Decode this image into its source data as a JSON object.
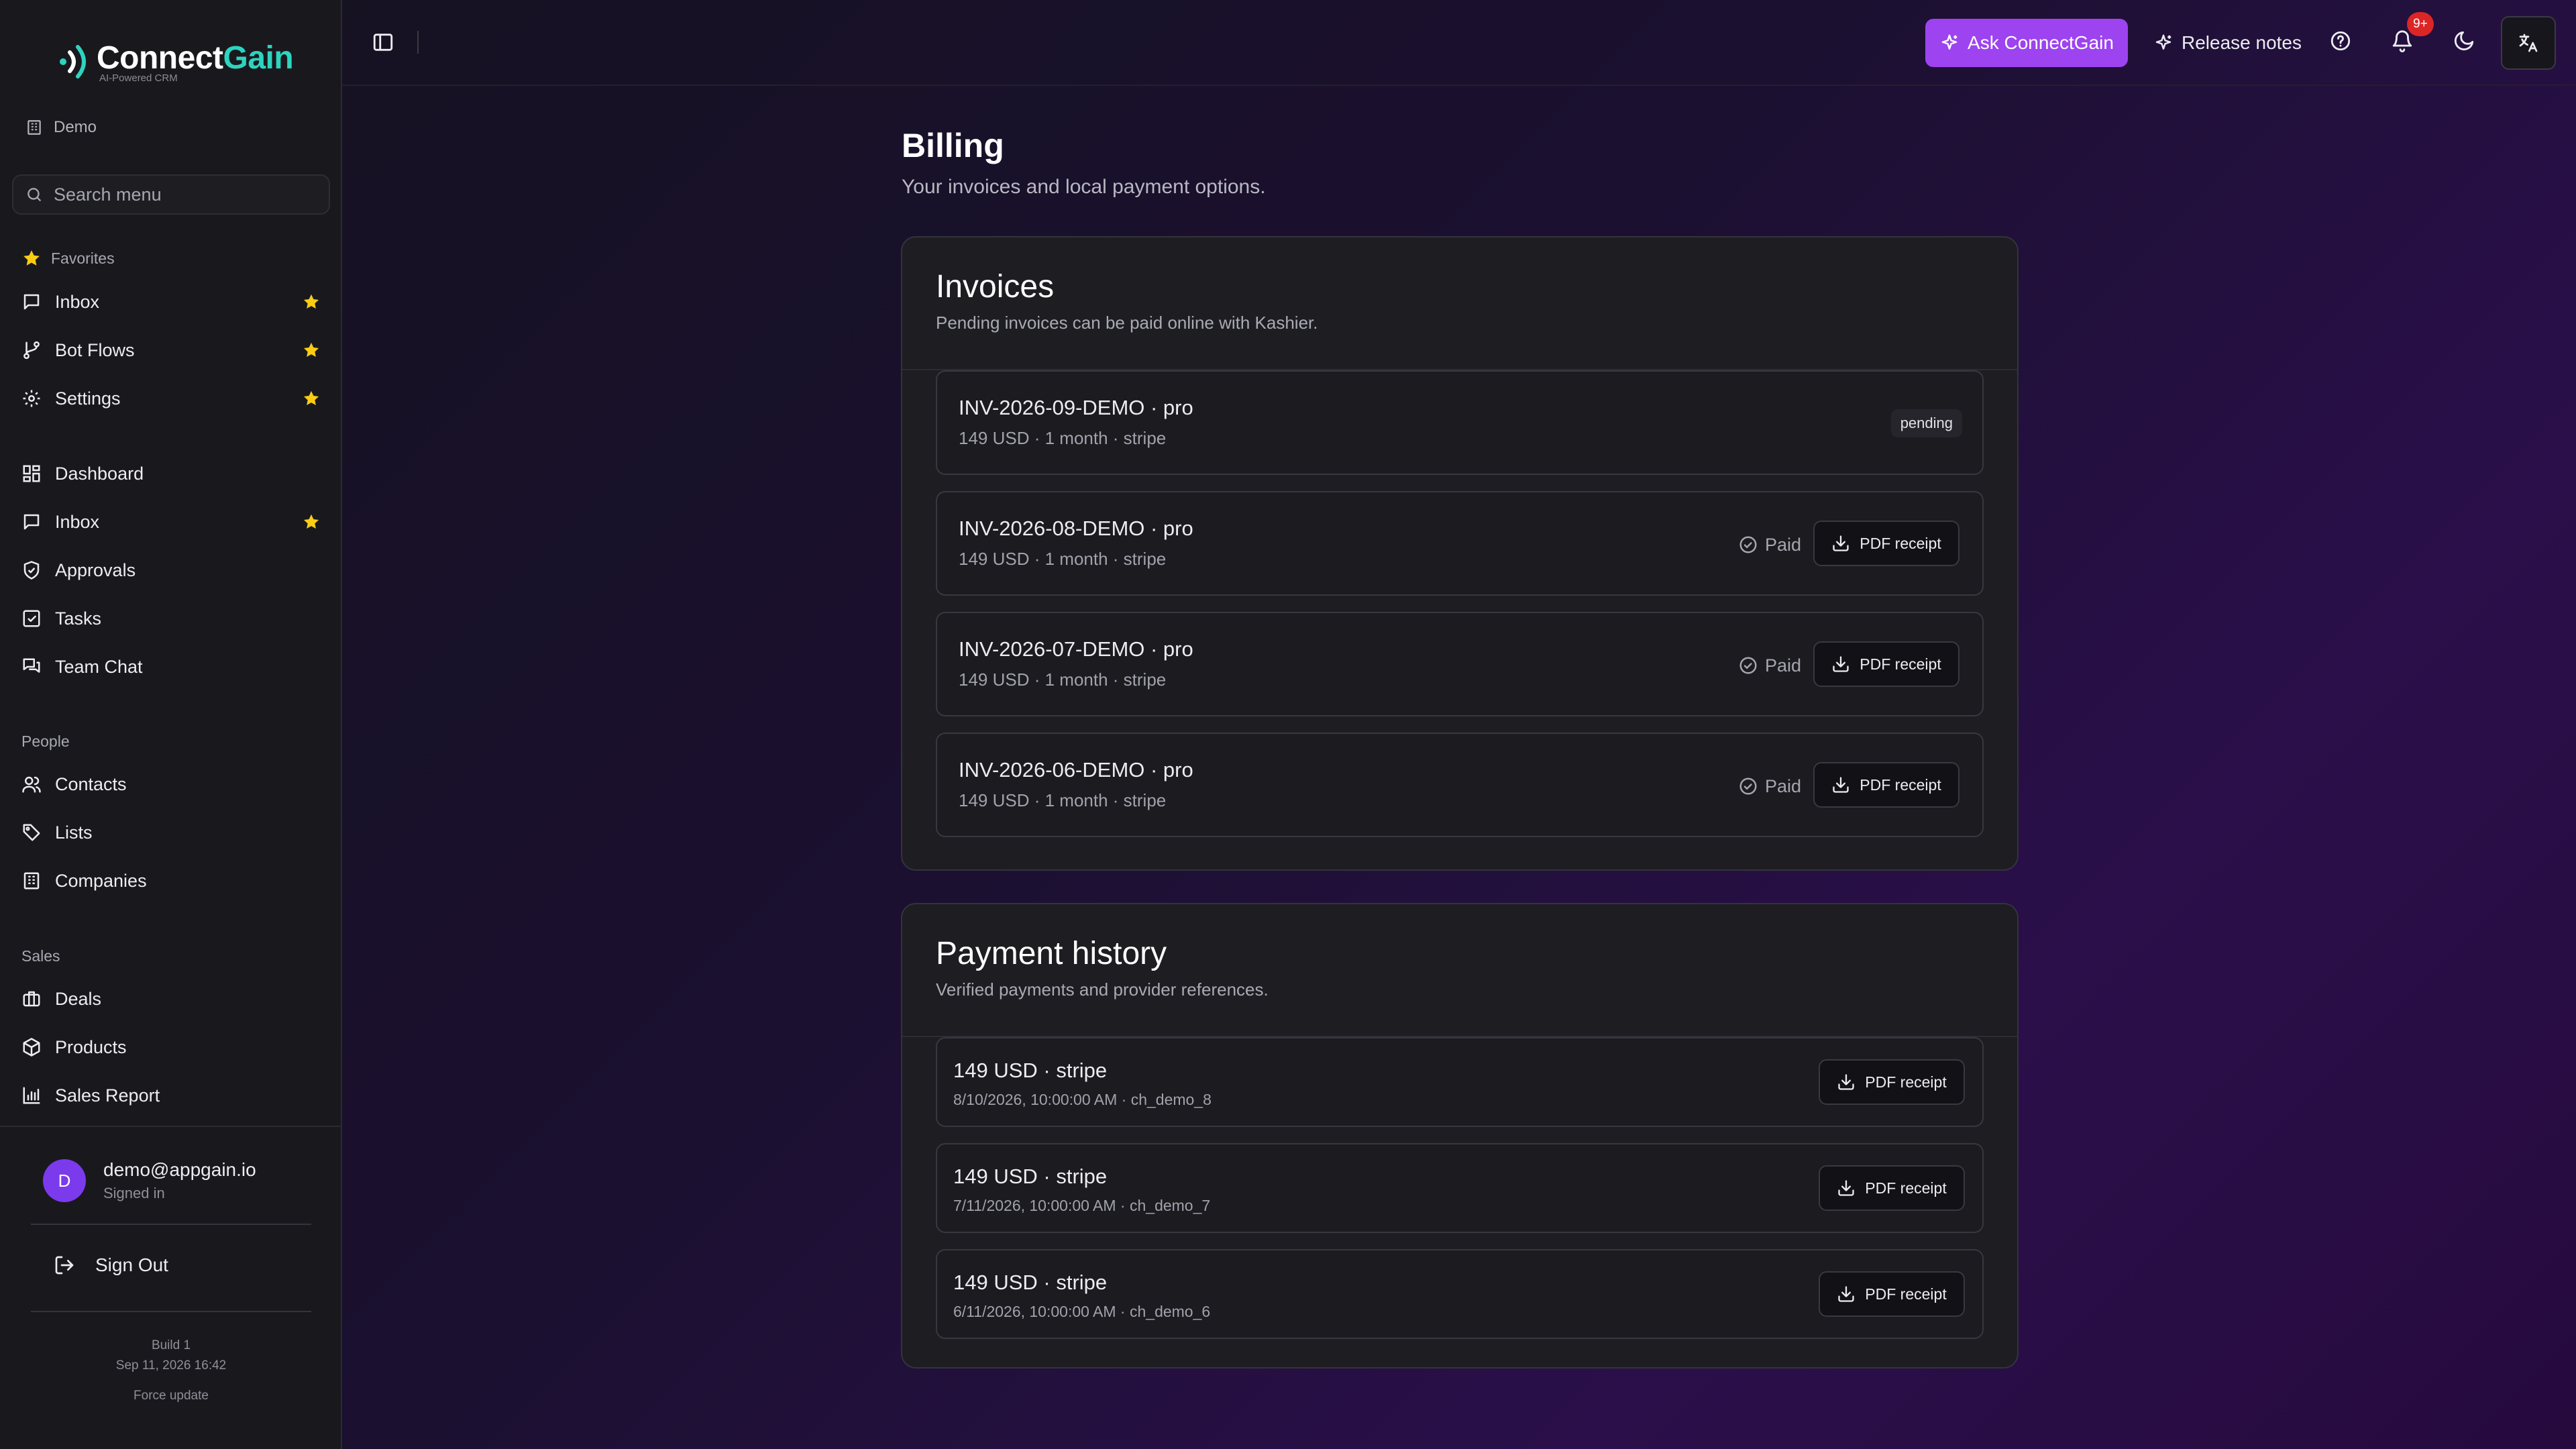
{
  "brand": {
    "name_a": "Connect",
    "name_b": "Gain",
    "tagline": "AI-Powered CRM",
    "accent": "#2dd4bf"
  },
  "workspace": {
    "name": "Demo",
    "icon": "building-icon"
  },
  "search": {
    "placeholder": "Search menu"
  },
  "sidebar": {
    "favorites_label": "Favorites",
    "favorites": [
      {
        "label": "Inbox",
        "icon": "message-square-icon",
        "starred": true
      },
      {
        "label": "Bot Flows",
        "icon": "git-branch-icon",
        "starred": true
      },
      {
        "label": "Settings",
        "icon": "gear-icon",
        "starred": true
      }
    ],
    "main": [
      {
        "label": "Dashboard",
        "icon": "layout-grid-icon",
        "starred": false
      },
      {
        "label": "Inbox",
        "icon": "message-square-icon",
        "starred": true
      },
      {
        "label": "Approvals",
        "icon": "shield-check-icon",
        "starred": false
      },
      {
        "label": "Tasks",
        "icon": "check-square-icon",
        "starred": false
      },
      {
        "label": "Team Chat",
        "icon": "messages-icon",
        "starred": false
      }
    ],
    "people_label": "People",
    "people": [
      {
        "label": "Contacts",
        "icon": "users-icon"
      },
      {
        "label": "Lists",
        "icon": "tag-icon"
      },
      {
        "label": "Companies",
        "icon": "building-icon"
      }
    ],
    "sales_label": "Sales",
    "sales": [
      {
        "label": "Deals",
        "icon": "briefcase-icon"
      },
      {
        "label": "Products",
        "icon": "package-icon"
      },
      {
        "label": "Sales Report",
        "icon": "bar-chart-icon"
      }
    ]
  },
  "user": {
    "initial": "D",
    "email": "demo@appgain.io",
    "status": "Signed in",
    "avatar_color": "#7c3aed"
  },
  "signout_label": "Sign Out",
  "build": {
    "label": "Build 1",
    "date": "Sep 11, 2026 16:42",
    "force_update": "Force update"
  },
  "topbar": {
    "ask_label": "Ask ConnectGain",
    "ask_color": "#9d43f0",
    "release_label": "Release notes",
    "notifications_badge": "9+"
  },
  "page": {
    "title": "Billing",
    "subtitle": "Your invoices and local payment options."
  },
  "invoices": {
    "title": "Invoices",
    "subtitle": "Pending invoices can be paid online with Kashier.",
    "items": [
      {
        "title": "INV-2026-09-DEMO · pro",
        "meta": "149 USD · 1 month · stripe",
        "status": "pending",
        "receipt": ""
      },
      {
        "title": "INV-2026-08-DEMO · pro",
        "meta": "149 USD · 1 month · stripe",
        "status": "Paid",
        "receipt": "PDF receipt"
      },
      {
        "title": "INV-2026-07-DEMO · pro",
        "meta": "149 USD · 1 month · stripe",
        "status": "Paid",
        "receipt": "PDF receipt"
      },
      {
        "title": "INV-2026-06-DEMO · pro",
        "meta": "149 USD · 1 month · stripe",
        "status": "Paid",
        "receipt": "PDF receipt"
      }
    ]
  },
  "payments": {
    "title": "Payment history",
    "subtitle": "Verified payments and provider references.",
    "items": [
      {
        "title": "149 USD · stripe",
        "meta": "8/10/2026, 10:00:00 AM · ch_demo_8",
        "receipt": "PDF receipt"
      },
      {
        "title": "149 USD · stripe",
        "meta": "7/11/2026, 10:00:00 AM · ch_demo_7",
        "receipt": "PDF receipt"
      },
      {
        "title": "149 USD · stripe",
        "meta": "6/11/2026, 10:00:00 AM · ch_demo_6",
        "receipt": "PDF receipt"
      }
    ]
  }
}
